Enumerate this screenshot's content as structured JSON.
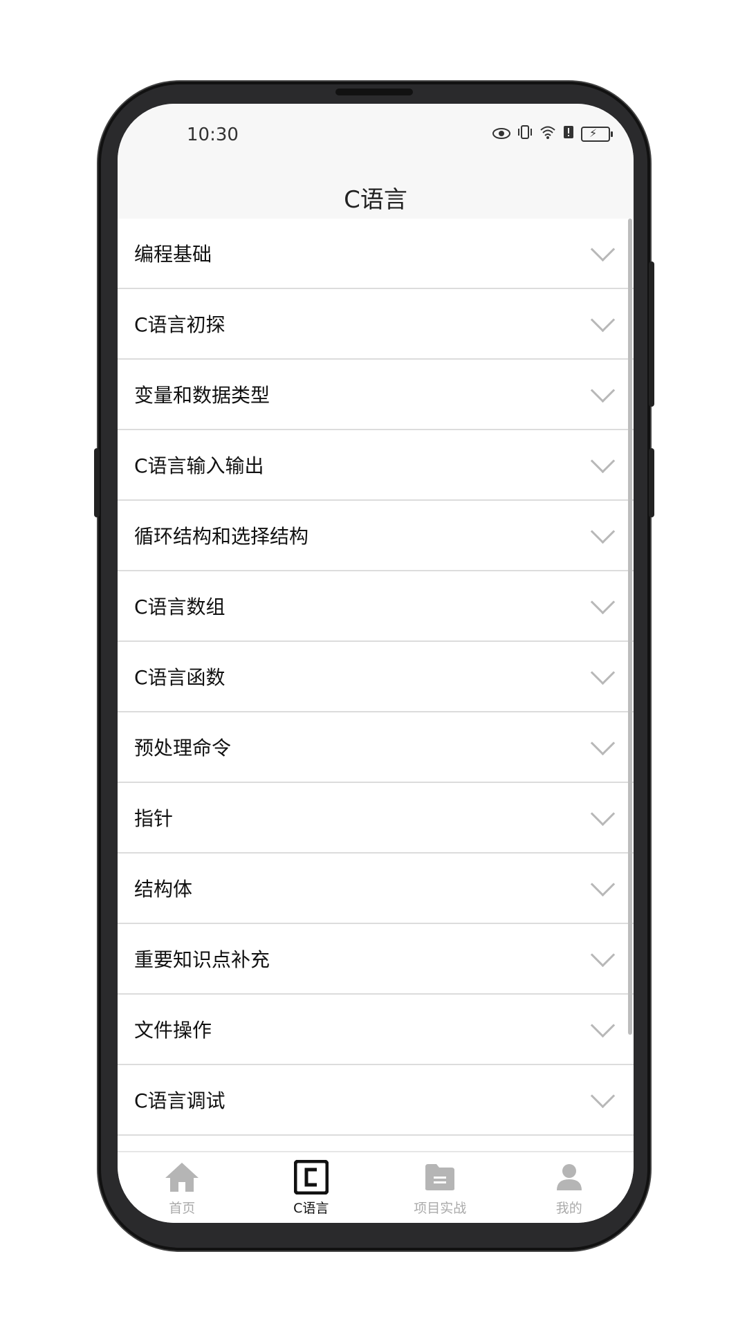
{
  "status_bar": {
    "time": "10:30"
  },
  "header": {
    "title": "C语言"
  },
  "list": {
    "items": [
      {
        "label": "编程基础"
      },
      {
        "label": "C语言初探"
      },
      {
        "label": "变量和数据类型"
      },
      {
        "label": "C语言输入输出"
      },
      {
        "label": "循环结构和选择结构"
      },
      {
        "label": "C语言数组"
      },
      {
        "label": "C语言函数"
      },
      {
        "label": "预处理命令"
      },
      {
        "label": "指针"
      },
      {
        "label": "结构体"
      },
      {
        "label": "重要知识点补充"
      },
      {
        "label": "文件操作"
      },
      {
        "label": "C语言调试"
      }
    ]
  },
  "tabbar": {
    "tabs": [
      {
        "label": "首页",
        "icon": "home-icon",
        "active": false
      },
      {
        "label": "C语言",
        "icon": "c-language-icon",
        "active": true
      },
      {
        "label": "项目实战",
        "icon": "folder-icon",
        "active": false
      },
      {
        "label": "我的",
        "icon": "user-icon",
        "active": false
      }
    ]
  },
  "colors": {
    "active_tab": "#111111",
    "inactive_tab": "#aaaaaa",
    "divider": "#dcdcdc",
    "header_bg": "#f7f7f7"
  }
}
